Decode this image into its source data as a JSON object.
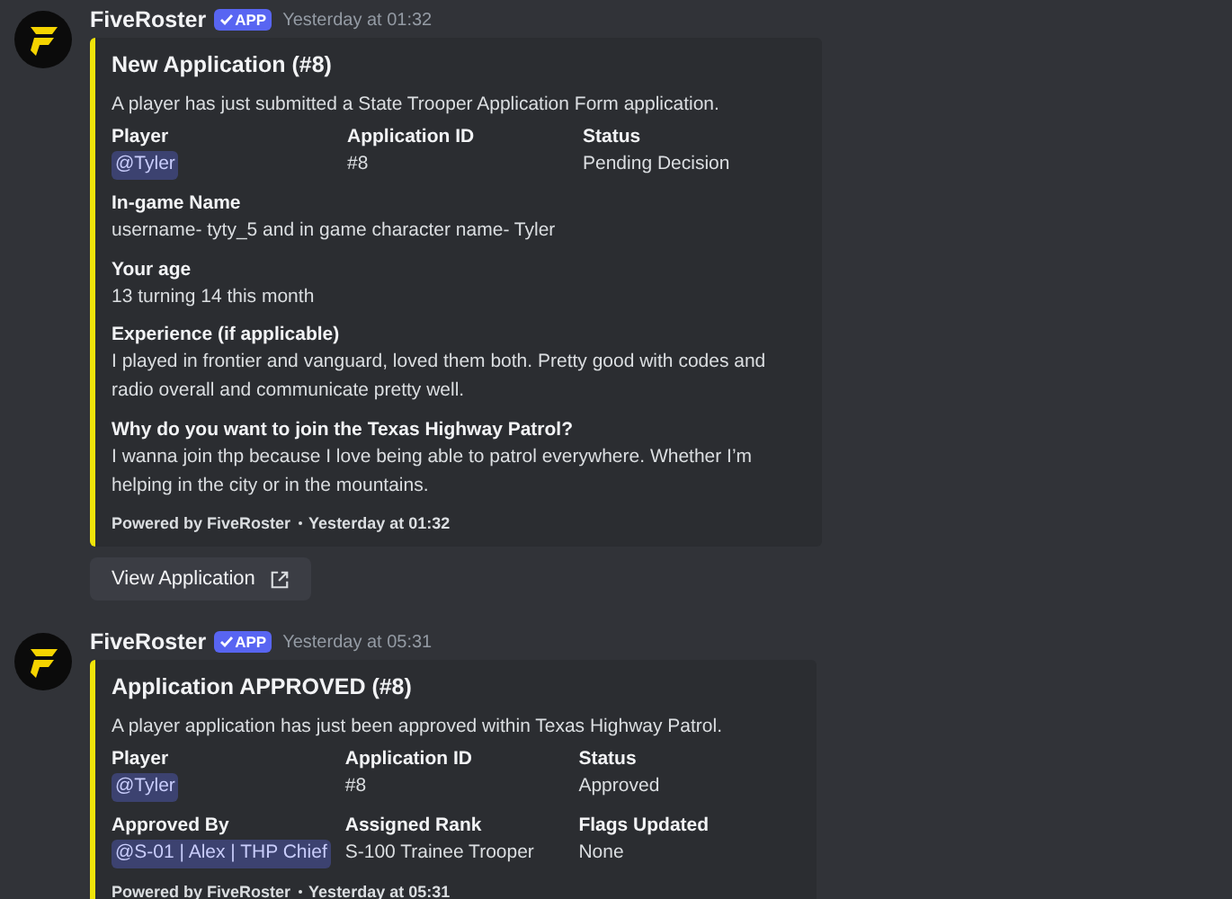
{
  "messages": [
    {
      "author": "FiveRoster",
      "badge": "APP",
      "timestamp": "Yesterday at 01:32",
      "embed": {
        "title": "New Application (#8)",
        "description": "A player has just submitted a State Trooper Application Form application.",
        "fields": [
          {
            "name": "Player",
            "value": "@Tyler",
            "inline": true,
            "mention": true
          },
          {
            "name": "Application ID",
            "value": "#8",
            "inline": true,
            "mention": false
          },
          {
            "name": "Status",
            "value": "Pending Decision",
            "inline": true,
            "mention": false
          },
          {
            "name": "In-game Name",
            "value": "username- tyty_5 and in game character name- Tyler",
            "inline": false,
            "mention": false
          },
          {
            "name": "Your age",
            "value": "13 turning 14 this month",
            "inline": false,
            "mention": false
          },
          {
            "name": "Experience (if applicable)",
            "value": "I played in frontier and vanguard, loved them both. Pretty good with codes and radio overall and communicate pretty well.",
            "inline": false,
            "mention": false
          },
          {
            "name": "Why do you want to join the Texas Highway Patrol?",
            "value": "I wanna join thp because I love being able to patrol everywhere. Whether I’m helping in the city or in the mountains.",
            "inline": false,
            "mention": false
          }
        ],
        "footer": {
          "text": "Powered by FiveRoster",
          "timestamp": "Yesterday at 01:32"
        }
      },
      "buttons": [
        {
          "label": "View Application"
        }
      ]
    },
    {
      "author": "FiveRoster",
      "badge": "APP",
      "timestamp": "Yesterday at 05:31",
      "embed": {
        "title": "Application APPROVED (#8)",
        "description": "A player application has just been approved within Texas Highway Patrol.",
        "fields": [
          {
            "name": "Player",
            "value": "@Tyler",
            "inline": true,
            "mention": true
          },
          {
            "name": "Application ID",
            "value": "#8",
            "inline": true,
            "mention": false
          },
          {
            "name": "Status",
            "value": "Approved",
            "inline": true,
            "mention": false
          },
          {
            "name": "Approved By",
            "value": "@S-01 | Alex | THP Chief",
            "inline": true,
            "mention": true
          },
          {
            "name": "Assigned Rank",
            "value": "S-100 Trainee Trooper",
            "inline": true,
            "mention": false
          },
          {
            "name": "Flags Updated",
            "value": "None",
            "inline": true,
            "mention": false
          }
        ],
        "footer": {
          "text": "Powered by FiveRoster",
          "timestamp": "Yesterday at 05:31"
        }
      }
    }
  ]
}
